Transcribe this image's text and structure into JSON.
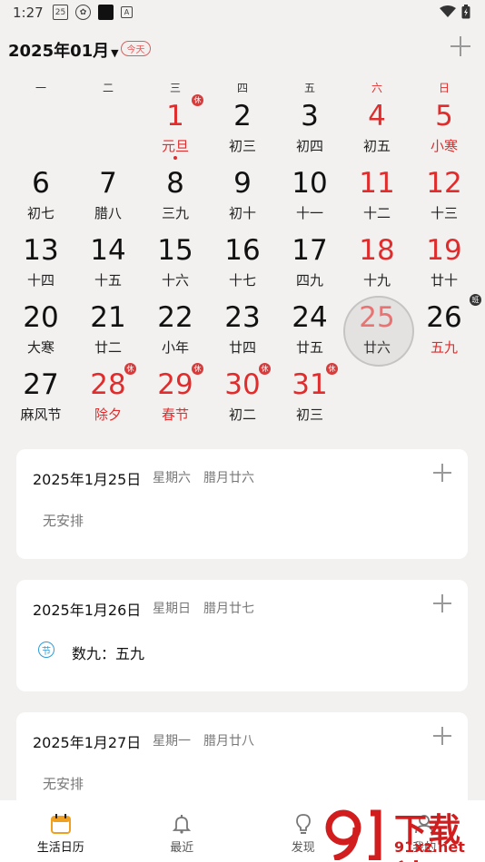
{
  "status_bar": {
    "time": "1:27",
    "calendar_icon_day": "25"
  },
  "header": {
    "month_title": "2025年01月",
    "today_label": "今天"
  },
  "weekdays": [
    "一",
    "二",
    "三",
    "四",
    "五",
    "六",
    "日"
  ],
  "days": [
    {
      "n": "",
      "l": ""
    },
    {
      "n": "",
      "l": ""
    },
    {
      "n": "1",
      "l": "元旦",
      "red": true,
      "badge": "休",
      "dot": true
    },
    {
      "n": "2",
      "l": "初三"
    },
    {
      "n": "3",
      "l": "初四"
    },
    {
      "n": "4",
      "l": "初五",
      "red_num": true
    },
    {
      "n": "5",
      "l": "小寒",
      "red": true
    },
    {
      "n": "6",
      "l": "初七"
    },
    {
      "n": "7",
      "l": "腊八"
    },
    {
      "n": "8",
      "l": "三九"
    },
    {
      "n": "9",
      "l": "初十"
    },
    {
      "n": "10",
      "l": "十一"
    },
    {
      "n": "11",
      "l": "十二",
      "red_num": true
    },
    {
      "n": "12",
      "l": "十三",
      "red_num": true
    },
    {
      "n": "13",
      "l": "十四"
    },
    {
      "n": "14",
      "l": "十五"
    },
    {
      "n": "15",
      "l": "十六"
    },
    {
      "n": "16",
      "l": "十七"
    },
    {
      "n": "17",
      "l": "四九"
    },
    {
      "n": "18",
      "l": "十九",
      "red_num": true
    },
    {
      "n": "19",
      "l": "廿十",
      "red_num": true
    },
    {
      "n": "20",
      "l": "大寒"
    },
    {
      "n": "21",
      "l": "廿二"
    },
    {
      "n": "22",
      "l": "小年"
    },
    {
      "n": "23",
      "l": "廿四"
    },
    {
      "n": "24",
      "l": "廿五"
    },
    {
      "n": "25",
      "l": "廿六",
      "selected": true
    },
    {
      "n": "26",
      "l": "五九",
      "red_lunar": true,
      "badge": "班",
      "badge_dark": true
    },
    {
      "n": "27",
      "l": "麻风节"
    },
    {
      "n": "28",
      "l": "除夕",
      "red": true,
      "badge": "休"
    },
    {
      "n": "29",
      "l": "春节",
      "red": true,
      "badge": "休"
    },
    {
      "n": "30",
      "l": "初二",
      "red_num": true,
      "badge": "休"
    },
    {
      "n": "31",
      "l": "初三",
      "red_num": true,
      "badge": "休"
    }
  ],
  "cards": [
    {
      "date": "2025年1月25日",
      "weekday": "星期六",
      "lunar": "腊月廿六",
      "empty": "无安排"
    },
    {
      "date": "2025年1月26日",
      "weekday": "星期日",
      "lunar": "腊月廿七",
      "event_icon": "节",
      "event": "数九：五九"
    },
    {
      "date": "2025年1月27日",
      "weekday": "星期一",
      "lunar": "腊月廿八",
      "empty": "无安排"
    }
  ],
  "tabs": [
    {
      "label": "生活日历",
      "icon": "calendar-icon",
      "active": true
    },
    {
      "label": "最近",
      "icon": "bell-icon"
    },
    {
      "label": "发现",
      "icon": "lightbulb-icon"
    },
    {
      "label": "我的",
      "icon": "user-icon"
    }
  ],
  "watermark": {
    "big": "下载站",
    "small": "91xz.net"
  },
  "colors": {
    "accent_red": "#e02c2c",
    "today_outline": "#e25a5a",
    "event_blue": "#2e9cd8",
    "active_tab": "#f0a020"
  }
}
